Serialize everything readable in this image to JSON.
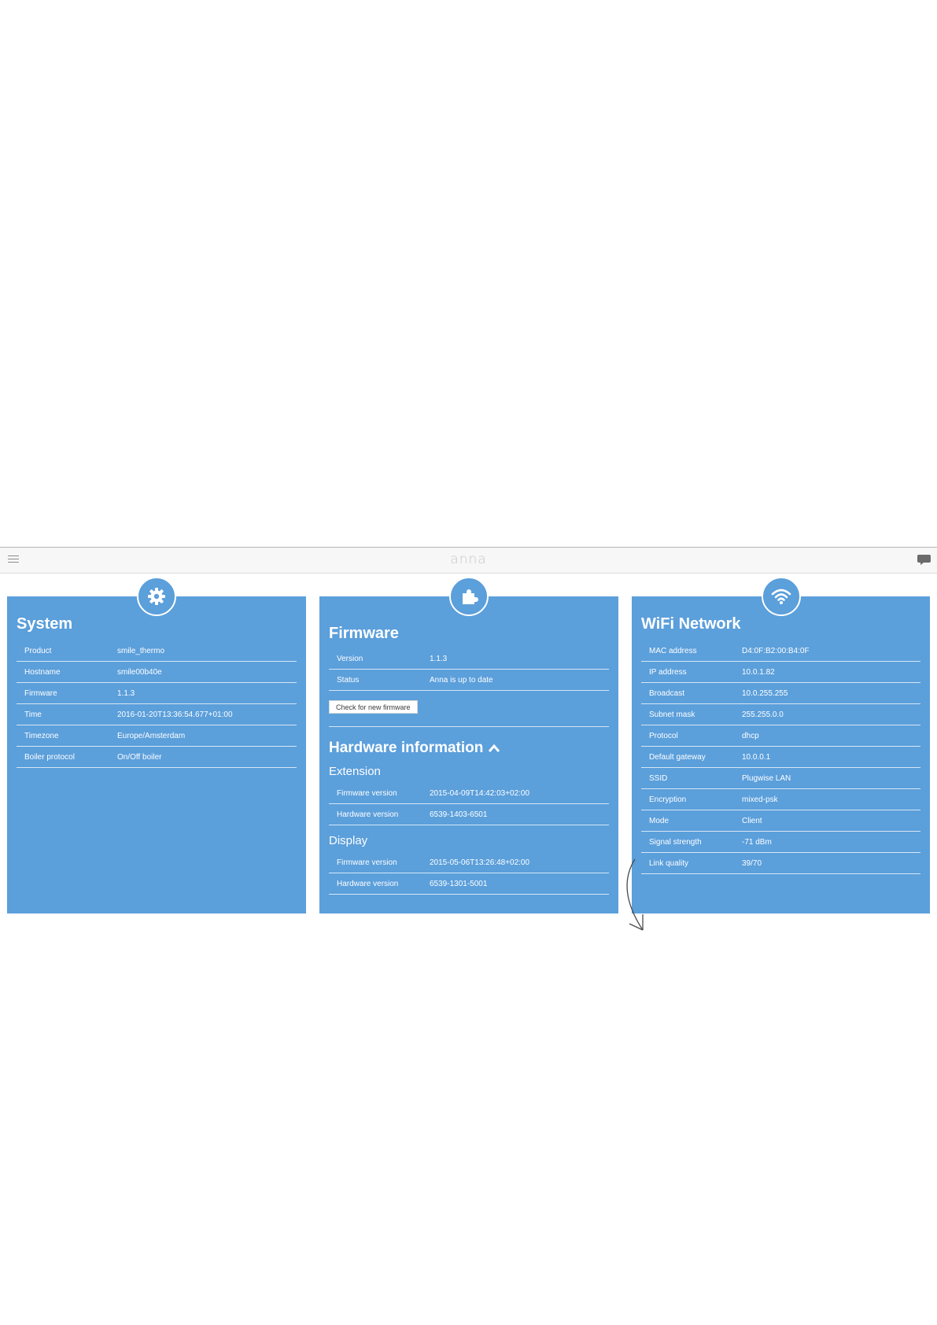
{
  "header": {
    "logo": "anna",
    "icons": {
      "menu": "hamburger-menu-icon",
      "chat": "chat-bubble-icon"
    }
  },
  "system": {
    "title": "System",
    "icon": "gear-icon",
    "rows": [
      {
        "label": "Product",
        "value": "smile_thermo"
      },
      {
        "label": "Hostname",
        "value": "smile00b40e"
      },
      {
        "label": "Firmware",
        "value": "1.1.3"
      },
      {
        "label": "Time",
        "value": "2016-01-20T13:36:54.677+01:00"
      },
      {
        "label": "Timezone",
        "value": "Europe/Amsterdam"
      },
      {
        "label": "Boiler protocol",
        "value": "On/Off boiler"
      }
    ]
  },
  "firmware": {
    "title": "Firmware",
    "icon": "puzzle-icon",
    "rows": [
      {
        "label": "Version",
        "value": "1.1.3"
      },
      {
        "label": "Status",
        "value": "Anna is up to date"
      }
    ],
    "check_button": "Check for new firmware",
    "hardware_title": "Hardware information",
    "extension": {
      "title": "Extension",
      "rows": [
        {
          "label": "Firmware version",
          "value": "2015-04-09T14:42:03+02:00"
        },
        {
          "label": "Hardware version",
          "value": "6539-1403-6501"
        }
      ]
    },
    "display": {
      "title": "Display",
      "rows": [
        {
          "label": "Firmware version",
          "value": "2015-05-06T13:26:48+02:00"
        },
        {
          "label": "Hardware version",
          "value": "6539-1301-5001"
        }
      ]
    }
  },
  "wifi": {
    "title": "WiFi Network",
    "icon": "wifi-icon",
    "rows": [
      {
        "label": "MAC address",
        "value": "D4:0F:B2:00:B4:0F"
      },
      {
        "label": "IP address",
        "value": "10.0.1.82"
      },
      {
        "label": "Broadcast",
        "value": "10.0.255.255"
      },
      {
        "label": "Subnet mask",
        "value": "255.255.0.0"
      },
      {
        "label": "Protocol",
        "value": "dhcp"
      },
      {
        "label": "Default gateway",
        "value": "10.0.0.1"
      },
      {
        "label": "SSID",
        "value": "Plugwise LAN"
      },
      {
        "label": "Encryption",
        "value": "mixed-psk"
      },
      {
        "label": "Mode",
        "value": "Client"
      },
      {
        "label": "Signal strength",
        "value": "-71 dBm"
      },
      {
        "label": "Link quality",
        "value": "39/70"
      }
    ]
  },
  "colors": {
    "panel": "#5b9fdb",
    "text": "#ffffff",
    "topbar": "#f7f7f7"
  }
}
